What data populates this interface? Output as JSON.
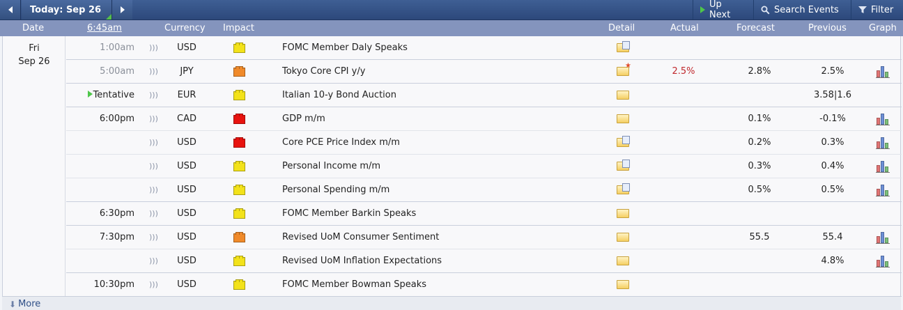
{
  "nav": {
    "today_label": "Today: Sep 26",
    "up_next": "Up Next",
    "search_events": "Search Events",
    "filter": "Filter"
  },
  "header": {
    "date": "Date",
    "time": "6:45am",
    "currency": "Currency",
    "impact": "Impact",
    "detail": "Detail",
    "actual": "Actual",
    "forecast": "Forecast",
    "previous": "Previous",
    "graph": "Graph"
  },
  "day": {
    "weekday": "Fri",
    "date": "Sep 26"
  },
  "colors": {
    "high": "#e8130f",
    "medium": "#f08a2a",
    "low": "#f3e21a",
    "actual_worse": "#c0282d",
    "nav_bg": "#2c487b",
    "header_bg": "#8494bd"
  },
  "rows": [
    {
      "time": "1:00am",
      "currency": "USD",
      "impact": "low",
      "event": "FOMC Member Daly Speaks",
      "detail_icon": "folder-doc-icon",
      "actual": "",
      "forecast": "",
      "previous": "",
      "graph": false,
      "past": true,
      "tentative": false
    },
    {
      "time": "5:00am",
      "currency": "JPY",
      "impact": "medium",
      "event": "Tokyo Core CPI y/y",
      "detail_icon": "folder-star-icon",
      "actual": "2.5%",
      "forecast": "2.8%",
      "previous": "2.5%",
      "graph": true,
      "past": true,
      "tentative": false
    },
    {
      "time": "Tentative",
      "currency": "EUR",
      "impact": "low",
      "event": "Italian 10-y Bond Auction",
      "detail_icon": "folder-icon",
      "actual": "",
      "forecast": "",
      "previous": "3.58|1.6",
      "graph": false,
      "past": false,
      "tentative": true
    },
    {
      "time": "6:00pm",
      "currency": "CAD",
      "impact": "high",
      "event": "GDP m/m",
      "detail_icon": "folder-icon",
      "actual": "",
      "forecast": "0.1%",
      "previous": "-0.1%",
      "graph": true,
      "past": false,
      "tentative": false
    },
    {
      "time": "",
      "currency": "USD",
      "impact": "high",
      "event": "Core PCE Price Index m/m",
      "detail_icon": "folder-doc-icon",
      "actual": "",
      "forecast": "0.2%",
      "previous": "0.3%",
      "graph": true,
      "past": false,
      "tentative": false
    },
    {
      "time": "",
      "currency": "USD",
      "impact": "low",
      "event": "Personal Income m/m",
      "detail_icon": "folder-doc-icon",
      "actual": "",
      "forecast": "0.3%",
      "previous": "0.4%",
      "graph": true,
      "past": false,
      "tentative": false
    },
    {
      "time": "",
      "currency": "USD",
      "impact": "low",
      "event": "Personal Spending m/m",
      "detail_icon": "folder-doc-icon",
      "actual": "",
      "forecast": "0.5%",
      "previous": "0.5%",
      "graph": true,
      "past": false,
      "tentative": false
    },
    {
      "time": "6:30pm",
      "currency": "USD",
      "impact": "low",
      "event": "FOMC Member Barkin Speaks",
      "detail_icon": "folder-icon",
      "actual": "",
      "forecast": "",
      "previous": "",
      "graph": false,
      "past": false,
      "tentative": false
    },
    {
      "time": "7:30pm",
      "currency": "USD",
      "impact": "medium",
      "event": "Revised UoM Consumer Sentiment",
      "detail_icon": "folder-icon",
      "actual": "",
      "forecast": "55.5",
      "previous": "55.4",
      "graph": true,
      "past": false,
      "tentative": false
    },
    {
      "time": "",
      "currency": "USD",
      "impact": "low",
      "event": "Revised UoM Inflation Expectations",
      "detail_icon": "folder-icon",
      "actual": "",
      "forecast": "",
      "previous": "4.8%",
      "graph": true,
      "past": false,
      "tentative": false
    },
    {
      "time": "10:30pm",
      "currency": "USD",
      "impact": "low",
      "event": "FOMC Member Bowman Speaks",
      "detail_icon": "folder-icon",
      "actual": "",
      "forecast": "",
      "previous": "",
      "graph": false,
      "past": false,
      "tentative": false
    }
  ],
  "footer": {
    "more": "More"
  }
}
